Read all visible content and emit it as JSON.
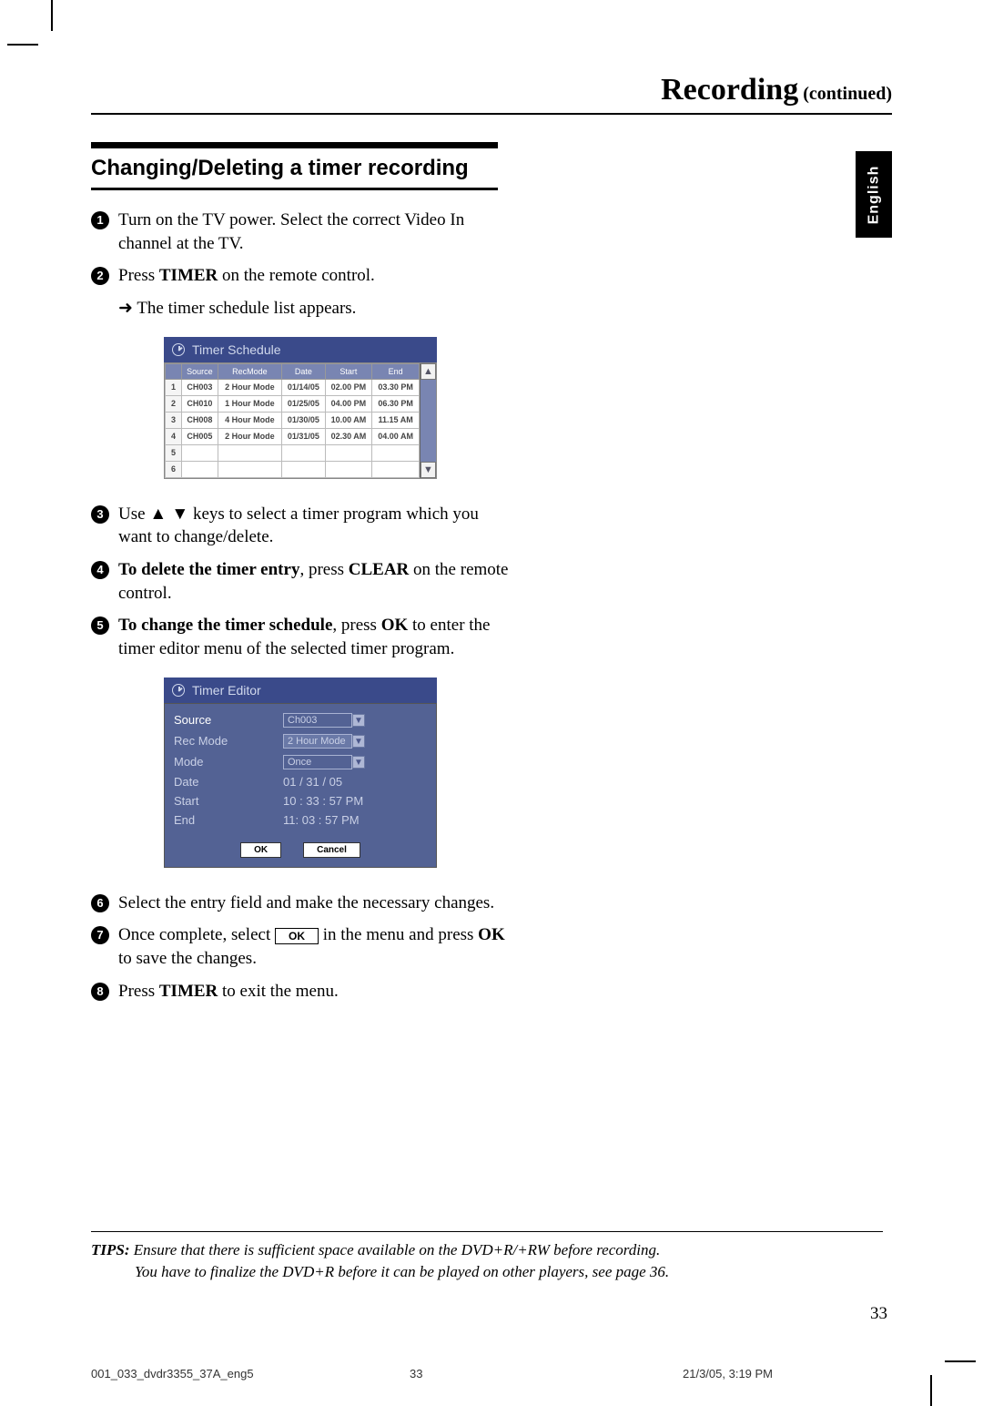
{
  "header": {
    "title": "Recording",
    "subtitle": " (continued)"
  },
  "lang_tab": "English",
  "section_heading": "Changing/Deleting a timer recording",
  "steps": {
    "s1": "Turn on the TV power.  Select the correct Video In channel at the TV.",
    "s2_a": "Press ",
    "s2_b": "TIMER",
    "s2_c": " on the remote control.",
    "s2_sub": "The timer schedule list appears.",
    "s3_a": "Use ",
    "s3_arrows": "▲ ▼",
    "s3_b": " keys to select a timer program which you want to change/delete.",
    "s4_a": "To delete the timer entry",
    "s4_b": ", press ",
    "s4_c": "CLEAR",
    "s4_d": " on the remote control.",
    "s5_a": "To change the timer schedule",
    "s5_b": ", press ",
    "s5_c": "OK",
    "s5_d": " to enter the timer editor menu of the selected timer program.",
    "s6": "Select the entry field and make the necessary changes.",
    "s7_a": "Once complete, select ",
    "s7_ok": "OK",
    "s7_b": " in the menu and press ",
    "s7_c": "OK",
    "s7_d": " to save the changes.",
    "s8_a": "Press ",
    "s8_b": "TIMER",
    "s8_c": " to exit the menu."
  },
  "timer_schedule": {
    "title": "Timer Schedule",
    "columns": [
      "",
      "Source",
      "RecMode",
      "Date",
      "Start",
      "End"
    ],
    "rows": [
      {
        "n": "1",
        "source": "CH003",
        "recmode": "2 Hour Mode",
        "date": "01/14/05",
        "start": "02.00 PM",
        "end": "03.30 PM"
      },
      {
        "n": "2",
        "source": "CH010",
        "recmode": "1 Hour Mode",
        "date": "01/25/05",
        "start": "04.00 PM",
        "end": "06.30 PM"
      },
      {
        "n": "3",
        "source": "CH008",
        "recmode": "4 Hour Mode",
        "date": "01/30/05",
        "start": "10.00 AM",
        "end": "11.15 AM"
      },
      {
        "n": "4",
        "source": "CH005",
        "recmode": "2 Hour Mode",
        "date": "01/31/05",
        "start": "02.30 AM",
        "end": "04.00 AM"
      },
      {
        "n": "5",
        "source": "",
        "recmode": "",
        "date": "",
        "start": "",
        "end": ""
      },
      {
        "n": "6",
        "source": "",
        "recmode": "",
        "date": "",
        "start": "",
        "end": ""
      }
    ]
  },
  "timer_editor": {
    "title": "Timer Editor",
    "fields": {
      "source_label": "Source",
      "source_val": "Ch003",
      "recmode_label": "Rec Mode",
      "recmode_val": "2 Hour Mode",
      "mode_label": "Mode",
      "mode_val": "Once",
      "date_label": "Date",
      "date_val": "01 / 31 / 05",
      "start_label": "Start",
      "start_val": "10 : 33 : 57 PM",
      "end_label": "End",
      "end_val": "11: 03 : 57 PM"
    },
    "ok_btn": "OK",
    "cancel_btn": "Cancel"
  },
  "tips": {
    "label": "TIPS:",
    "line1": "Ensure that there is sufficient space available on the DVD+R/+RW before recording.",
    "line2": "You have to finalize the DVD+R before it can be played on other players, see page 36."
  },
  "page_number": "33",
  "footer": {
    "file": "001_033_dvdr3355_37A_eng5",
    "page": "33",
    "datetime": "21/3/05, 3:19 PM"
  }
}
